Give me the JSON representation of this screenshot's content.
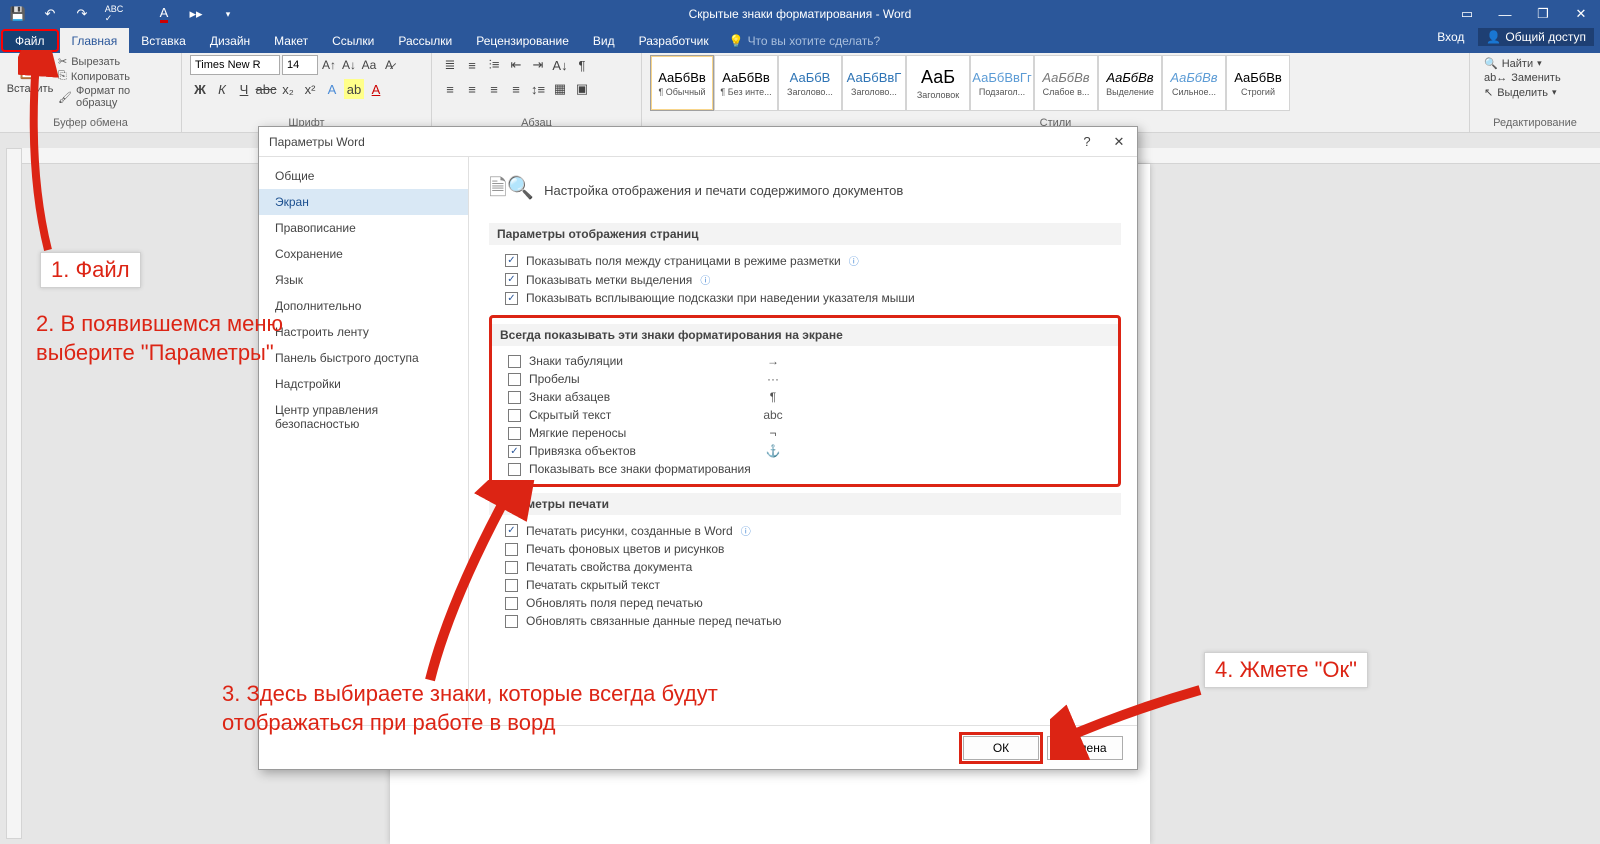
{
  "app": {
    "title": "Скрытые знаки форматирования - Word"
  },
  "menubar": {
    "file": "Файл",
    "tabs": [
      "Главная",
      "Вставка",
      "Дизайн",
      "Макет",
      "Ссылки",
      "Рассылки",
      "Рецензирование",
      "Вид",
      "Разработчик"
    ],
    "tellme_placeholder": "Что вы хотите сделать?",
    "signin": "Вход",
    "share": "Общий доступ"
  },
  "ribbon": {
    "clipboard": {
      "paste": "Вставить",
      "cut": "Вырезать",
      "copy": "Копировать",
      "format_painter": "Формат по образцу",
      "group_label": "Буфер обмена"
    },
    "font": {
      "name": "Times New R",
      "size": "14",
      "group_label": "Шрифт"
    },
    "paragraph": {
      "group_label": "Абзац"
    },
    "styles": {
      "items": [
        {
          "sample": "АаБбВв",
          "label": "¶ Обычный"
        },
        {
          "sample": "АаБбВв",
          "label": "¶ Без инте..."
        },
        {
          "sample": "АаБбВ",
          "label": "Заголово..."
        },
        {
          "sample": "АаБбВвГ",
          "label": "Заголово..."
        },
        {
          "sample": "АаБ",
          "label": "Заголовок"
        },
        {
          "sample": "АаБбВвГг",
          "label": "Подзагол..."
        },
        {
          "sample": "АаБбВв",
          "label": "Слабое в..."
        },
        {
          "sample": "АаБбВв",
          "label": "Выделение"
        },
        {
          "sample": "АаБбВв",
          "label": "Сильное..."
        },
        {
          "sample": "АаБбВв",
          "label": "Строгий"
        }
      ],
      "group_label": "Стили"
    },
    "editing": {
      "find": "Найти",
      "replace": "Заменить",
      "select": "Выделить",
      "group_label": "Редактирование"
    }
  },
  "dialog": {
    "title": "Параметры Word",
    "nav": [
      "Общие",
      "Экран",
      "Правописание",
      "Сохранение",
      "Язык",
      "Дополнительно",
      "Настроить ленту",
      "Панель быстрого доступа",
      "Надстройки",
      "Центр управления безопасностью"
    ],
    "nav_selected": 1,
    "heading": "Настройка отображения и печати содержимого документов",
    "section1": {
      "title": "Параметры отображения страниц",
      "opts": [
        {
          "label": "Показывать поля между страницами в режиме разметки",
          "checked": true,
          "info": true
        },
        {
          "label": "Показывать метки выделения",
          "checked": true,
          "info": true
        },
        {
          "label": "Показывать всплывающие подсказки при наведении указателя мыши",
          "checked": true
        }
      ]
    },
    "section2": {
      "title": "Всегда показывать эти знаки форматирования на экране",
      "opts": [
        {
          "label": "Знаки табуляции",
          "checked": false,
          "sym": "→"
        },
        {
          "label": "Пробелы",
          "checked": false,
          "sym": "···"
        },
        {
          "label": "Знаки абзацев",
          "checked": false,
          "sym": "¶"
        },
        {
          "label": "Скрытый текст",
          "checked": false,
          "sym": "abc"
        },
        {
          "label": "Мягкие переносы",
          "checked": false,
          "sym": "¬"
        },
        {
          "label": "Привязка объектов",
          "checked": true,
          "sym": "⚓"
        },
        {
          "label": "Показывать все знаки форматирования",
          "checked": false
        }
      ]
    },
    "section3": {
      "title": "Параметры печати",
      "opts": [
        {
          "label": "Печатать рисунки, созданные в Word",
          "checked": true,
          "info": true
        },
        {
          "label": "Печать фоновых цветов и рисунков",
          "checked": false
        },
        {
          "label": "Печатать свойства документа",
          "checked": false
        },
        {
          "label": "Печатать скрытый текст",
          "checked": false
        },
        {
          "label": "Обновлять поля перед печатью",
          "checked": false
        },
        {
          "label": "Обновлять связанные данные перед печатью",
          "checked": false
        }
      ]
    },
    "ok": "ОК",
    "cancel": "Отмена"
  },
  "annotations": {
    "a1": "1. Файл",
    "a2": "2. В появившемся меню выберите \"Параметры\"",
    "a3": "3. Здесь выбираете знаки, которые всегда будут отображаться при работе в ворд",
    "a4": "4. Жмете \"Ок\""
  }
}
